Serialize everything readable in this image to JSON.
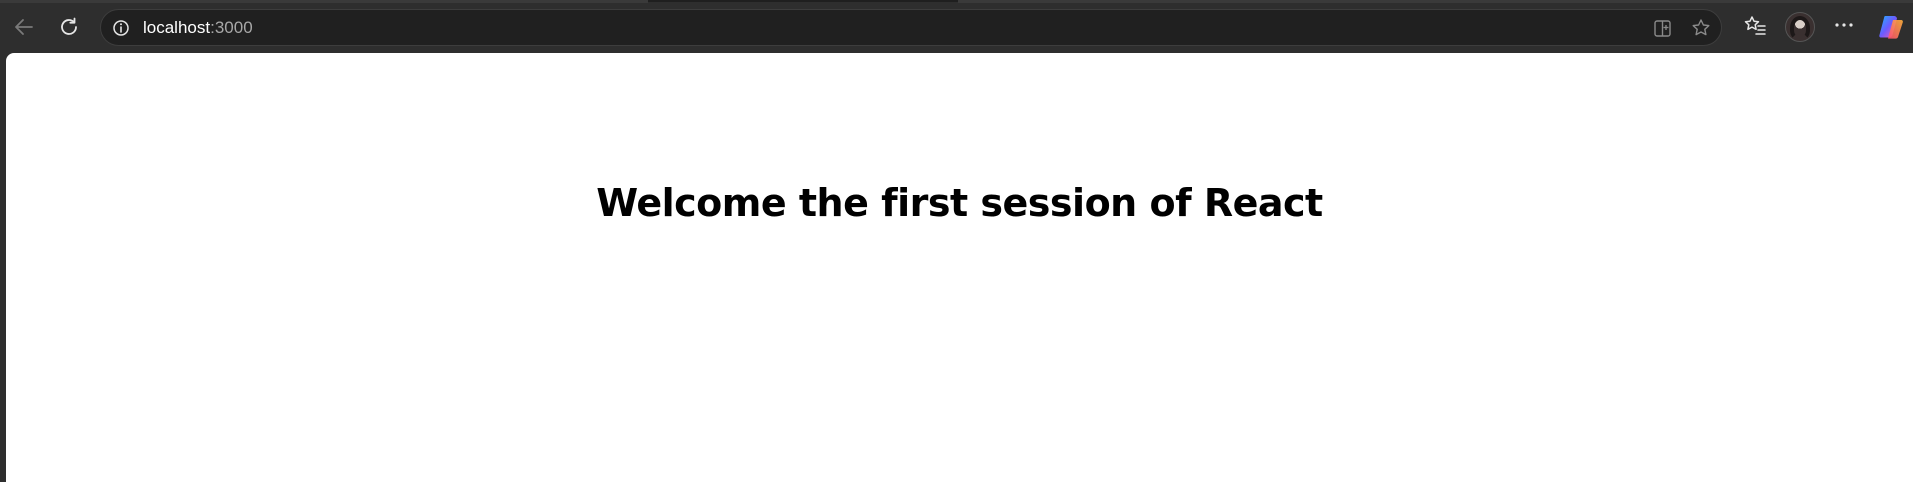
{
  "browser": {
    "address": {
      "host": "localhost",
      "port": ":3000"
    },
    "toolbar": {
      "back_icon": "back-arrow-icon",
      "reload_icon": "reload-icon",
      "info_icon": "site-info-icon",
      "split_icon": "split-screen-icon",
      "favorite_icon": "star-icon",
      "favorites_icon": "favorites-list-icon",
      "profile_icon": "avatar",
      "more_icon": "more-icon",
      "copilot_icon": "copilot-icon"
    },
    "colors": {
      "chrome": "#2e2e2e",
      "address_bg": "#202020",
      "page_bg": "#ffffff"
    }
  },
  "page": {
    "heading": "Welcome the first session of React"
  }
}
